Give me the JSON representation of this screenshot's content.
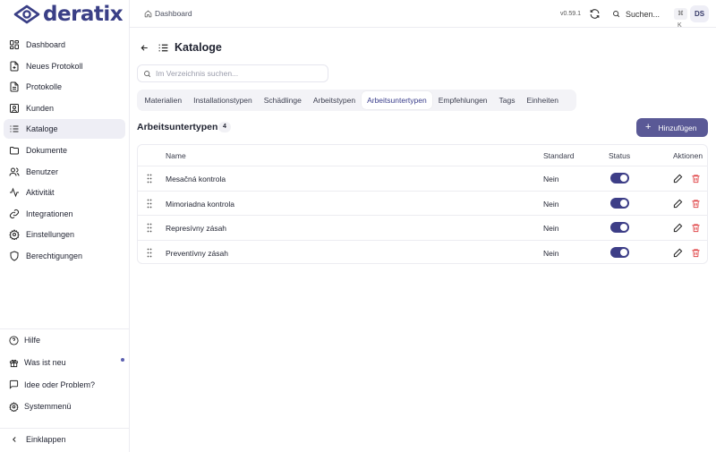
{
  "brand": {
    "name": "deratix",
    "color": "#3a3f86"
  },
  "sidebar": {
    "items": [
      {
        "label": "Dashboard",
        "icon": "layout-dashboard-icon"
      },
      {
        "label": "Neues Protokoll",
        "icon": "file-plus-icon"
      },
      {
        "label": "Protokolle",
        "icon": "file-text-icon"
      },
      {
        "label": "Kunden",
        "icon": "user-icon"
      },
      {
        "label": "Kataloge",
        "icon": "list-icon",
        "active": true
      },
      {
        "label": "Dokumente",
        "icon": "folder-icon"
      },
      {
        "label": "Benutzer",
        "icon": "users-icon"
      },
      {
        "label": "Aktivität",
        "icon": "activity-icon"
      },
      {
        "label": "Integrationen",
        "icon": "link-icon"
      },
      {
        "label": "Einstellungen",
        "icon": "settings-icon"
      },
      {
        "label": "Berechtigungen",
        "icon": "shield-icon"
      }
    ],
    "bottom": [
      {
        "label": "Hilfe",
        "icon": "help-circle-icon"
      },
      {
        "label": "Was ist neu",
        "icon": "gift-icon"
      },
      {
        "label": "Idee oder Problem?",
        "icon": "message-icon"
      },
      {
        "label": "Systemmenü",
        "icon": "settings-icon"
      }
    ],
    "collapse_label": "Einklappen"
  },
  "header": {
    "breadcrumb": "Dashboard",
    "version": "v0.59.1",
    "search_label": "Suchen...",
    "shortcut": "⌘ K",
    "avatar_initials": "DS"
  },
  "page": {
    "title": "Kataloge",
    "search_placeholder": "Im Verzeichnis suchen...",
    "tabs": [
      {
        "label": "Materialien"
      },
      {
        "label": "Installationstypen"
      },
      {
        "label": "Schädlinge"
      },
      {
        "label": "Arbeitstypen"
      },
      {
        "label": "Arbeitsuntertypen",
        "active": true
      },
      {
        "label": "Empfehlungen"
      },
      {
        "label": "Tags"
      },
      {
        "label": "Einheiten"
      }
    ],
    "section_title": "Arbeitsuntertypen",
    "count": "4",
    "add_label": "Hinzufügen",
    "accent_color": "#5a5996"
  },
  "table": {
    "columns": {
      "name": "Name",
      "standard": "Standard",
      "status": "Status",
      "actions": "Aktionen"
    },
    "rows": [
      {
        "name": "Mesačná kontrola",
        "standard": "Nein",
        "status": true
      },
      {
        "name": "Mimoriadna kontrola",
        "standard": "Nein",
        "status": true
      },
      {
        "name": "Represívny zásah",
        "standard": "Nein",
        "status": true
      },
      {
        "name": "Preventívny zásah",
        "standard": "Nein",
        "status": true
      }
    ]
  }
}
